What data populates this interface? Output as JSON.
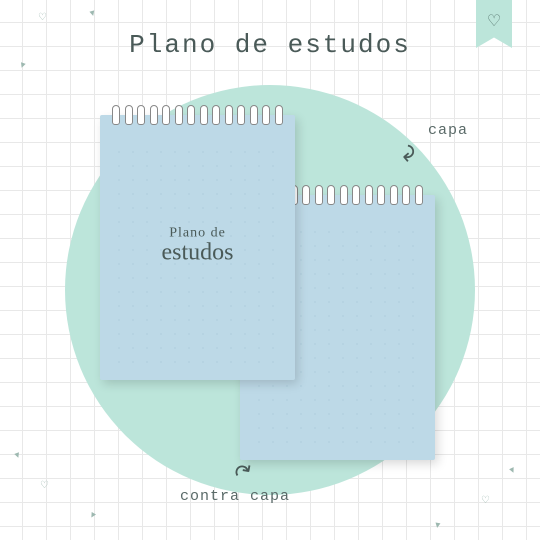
{
  "title": "Plano de estudos",
  "cover": {
    "line1": "Plano de",
    "line2": "estudos"
  },
  "labels": {
    "capa": "capa",
    "contra_capa": "contra capa"
  }
}
